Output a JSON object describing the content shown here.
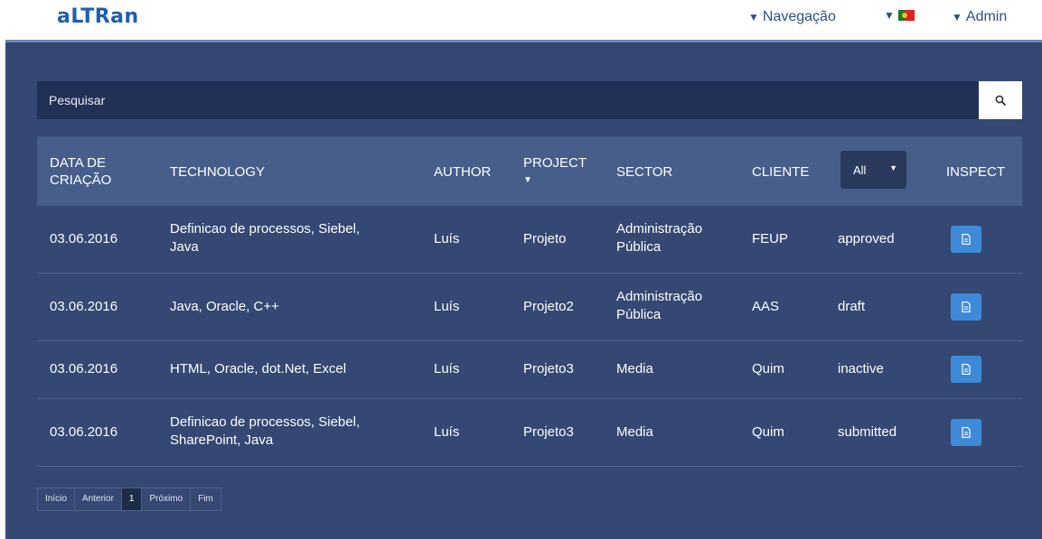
{
  "brand": {
    "logo_text": "aLTRan"
  },
  "nav": {
    "navigation_label": "Navegação",
    "admin_label": "Admin"
  },
  "search": {
    "placeholder": "Pesquisar"
  },
  "table": {
    "headers": {
      "date": [
        "DATA DE",
        "CRIAÇÃO"
      ],
      "technology": "TECHNOLOGY",
      "author": "AUTHOR",
      "project": "PROJECT",
      "sector": "SECTOR",
      "client": "CLIENTE",
      "status_filter": "All",
      "inspect": "INSPECT"
    },
    "rows": [
      {
        "date": "03.06.2016",
        "technology": [
          "Definicao de processos, Siebel,",
          "Java"
        ],
        "author": "Luís",
        "project": "Projeto",
        "sector": [
          "Administração",
          "Pública"
        ],
        "client": "FEUP",
        "status": "approved"
      },
      {
        "date": "03.06.2016",
        "technology": [
          "Java, Oracle, C++"
        ],
        "author": "Luís",
        "project": "Projeto2",
        "sector": [
          "Administração",
          "Pública"
        ],
        "client": "AAS",
        "status": "draft"
      },
      {
        "date": "03.06.2016",
        "technology": [
          "HTML, Oracle, dot.Net, Excel"
        ],
        "author": "Luís",
        "project": "Projeto3",
        "sector": [
          "Media"
        ],
        "client": "Quim",
        "status": "inactive"
      },
      {
        "date": "03.06.2016",
        "technology": [
          "Definicao de processos, Siebel,",
          "SharePoint, Java"
        ],
        "author": "Luís",
        "project": "Projeto3",
        "sector": [
          "Media"
        ],
        "client": "Quim",
        "status": "submitted"
      }
    ]
  },
  "pagination": {
    "first": "Início",
    "prev": "Anterior",
    "current": "1",
    "next": "Próximo",
    "last": "Fim"
  },
  "colors": {
    "panel_bg": "#344873",
    "header_bg": "#475d8a",
    "search_bg": "#213155",
    "inspect_button": "#3f8ad8",
    "brand": "#1f5fae"
  },
  "icons": {
    "search": "search-icon",
    "inspect": "document-icon",
    "dropdown": "caret-down-icon",
    "flag": "portugal-flag-icon"
  }
}
